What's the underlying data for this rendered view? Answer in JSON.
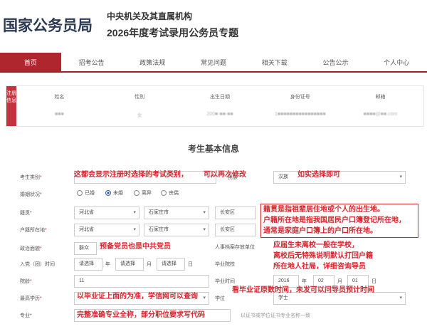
{
  "header": {
    "site_title": "国家公务员局",
    "subtitle1": "中央机关及其直属机构",
    "subtitle2": "2026年度考试录用公务员专题"
  },
  "nav": {
    "items": [
      "首页",
      "招考公告",
      "政策法规",
      "常见问题",
      "相关下载",
      "公告公示",
      "个人中心"
    ],
    "active_index": 0
  },
  "registration": {
    "tab_label": "注册信息",
    "headers": [
      "姓名",
      "性别",
      "出生日期",
      "身份证号",
      "邮箱"
    ],
    "values": [
      "■■■",
      "女",
      "200■-■■-■■",
      "1■■■■■■■■■■■■■■■■",
      "■■■■@■■.com"
    ]
  },
  "form": {
    "title": "考生基本信息",
    "labels": {
      "category": "考生类别",
      "marital": "婚姻状况",
      "native": "籍贯",
      "hukou": "户籍所在地",
      "political": "政治面貌",
      "party_date": "入党（团）时间",
      "seniority": "院龄",
      "education": "最高学历",
      "major": "专业",
      "archive_unit": "人事档案存放单位",
      "work_unit": "毕业院校",
      "grad_date": "毕业时间",
      "degree": "学位"
    },
    "ethnicity_label": "民族",
    "ethnicity_value": "汉族",
    "marital_options": [
      "已婚",
      "未婚",
      "离异",
      "丧偶"
    ],
    "marital_selected": 1,
    "native_province": "河北省",
    "native_city": "石家庄市",
    "native_district": "长安区",
    "hukou_province": "河北省",
    "hukou_city": "石家庄市",
    "hukou_district": "长安区",
    "political_value": "群众",
    "party_year_placeholder": "请选择",
    "party_month_placeholder": "请选择",
    "party_day_placeholder": "请选择",
    "unit_year": "年",
    "unit_month": "月",
    "unit_day": "日",
    "seniority_value": "11",
    "grad_year": "2016",
    "grad_month": "02",
    "grad_day": "01",
    "degree_value": "学士",
    "major_hint": "以证书或学位证书专业名称一致"
  },
  "annotations": {
    "a1": "这都会显示注册时选择的考试类别，",
    "a1b": "可以再次修改",
    "a2": "如实选择即可",
    "a3_line1": "籍贯是指祖辈居住地或个人的出生地。",
    "a3_line2": "户籍所在地是指我国居民户口簿登记所在地，",
    "a3_line3": "通常是家庭户口簿上的户口所在地。",
    "a4": "预备党员也是中共党员",
    "a5_line1": "应届生未离校一般在学校，",
    "a5_line2": "离校后无特殊说明默认打回户籍",
    "a5_line3": "所在地人社局，详细咨询导员",
    "a6": "以毕业证上面的为准，学信网可以查询",
    "a7": "看毕业证原数时间，未发可以问导员预计时间",
    "a8": "完整准确专业全称，部分职位要求写代码"
  },
  "colors": {
    "brand_red": "#b0262e",
    "annotation_red": "#d3272f",
    "title_blue": "#2b3a55"
  }
}
